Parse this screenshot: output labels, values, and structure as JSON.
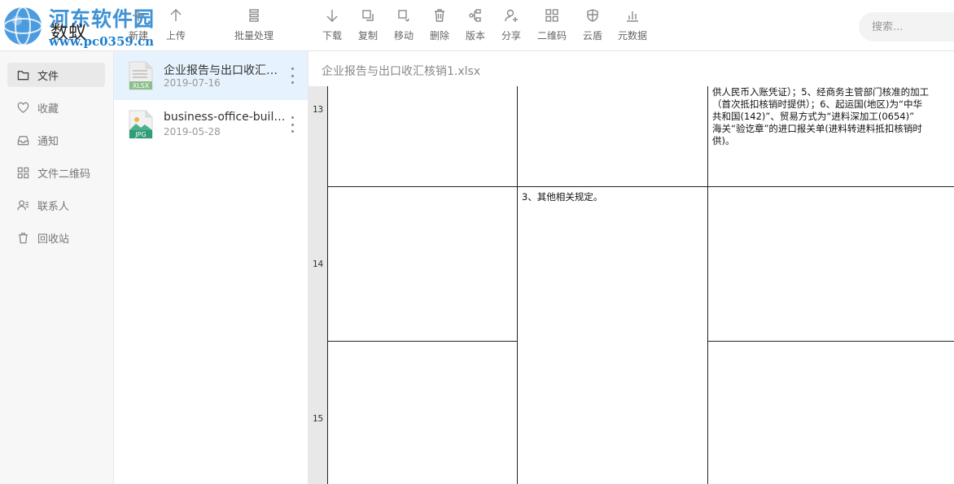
{
  "app": {
    "watermark": "河东软件园",
    "watermark_url": "www.pc0359.cn",
    "name": "数蚁"
  },
  "toolbar": {
    "items": [
      {
        "id": "new",
        "label": "新建",
        "icon": "plus-icon"
      },
      {
        "id": "upload",
        "label": "上传",
        "icon": "arrow-up-icon"
      },
      {
        "id": "batch",
        "label": "批量处理",
        "icon": "list-icon"
      },
      {
        "id": "download",
        "label": "下载",
        "icon": "arrow-down-icon"
      },
      {
        "id": "copy",
        "label": "复制",
        "icon": "copy-icon"
      },
      {
        "id": "move",
        "label": "移动",
        "icon": "move-icon"
      },
      {
        "id": "delete",
        "label": "删除",
        "icon": "trash-icon"
      },
      {
        "id": "version",
        "label": "版本",
        "icon": "version-icon"
      },
      {
        "id": "share",
        "label": "分享",
        "icon": "share-user-icon"
      },
      {
        "id": "qrcode",
        "label": "二维码",
        "icon": "qrcode-icon"
      },
      {
        "id": "cloudshield",
        "label": "云盾",
        "icon": "shield-icon"
      },
      {
        "id": "metadata",
        "label": "元数据",
        "icon": "bar-chart-icon"
      }
    ]
  },
  "search": {
    "placeholder": "搜索..."
  },
  "sidebar": {
    "items": [
      {
        "label": "文件",
        "icon": "folder-icon",
        "active": true
      },
      {
        "label": "收藏",
        "icon": "heart-icon",
        "active": false
      },
      {
        "label": "通知",
        "icon": "inbox-icon",
        "active": false
      },
      {
        "label": "文件二维码",
        "icon": "qrcode-icon",
        "active": false
      },
      {
        "label": "联系人",
        "icon": "contacts-icon",
        "active": false
      },
      {
        "label": "回收站",
        "icon": "trash-icon",
        "active": false
      }
    ]
  },
  "files": [
    {
      "name": "企业报告与出口收汇核销1.xlsx",
      "date": "2019-07-16",
      "type": "XLSX",
      "selected": true
    },
    {
      "name": "business-office-building.jpg",
      "date": "2019-05-28",
      "type": "JPG",
      "selected": false
    }
  ],
  "preview": {
    "title": "企业报告与出口收汇核销1.xlsx",
    "rows": [
      {
        "num": "13"
      },
      {
        "num": "14"
      },
      {
        "num": "15"
      }
    ],
    "cell_13_c": [
      "供人民币入账凭证）；5、经商务主管部门核准的加工",
      "（首次抵扣核销时提供）；6、起运国(地区)为“中华",
      "共和国(142)”、贸易方式为“进料深加工(0654)”",
      "海关“验讫章”的进口报关单(进料转进料抵扣核销时",
      "供)。"
    ],
    "cell_14_b": "3、其他相关规定。"
  }
}
